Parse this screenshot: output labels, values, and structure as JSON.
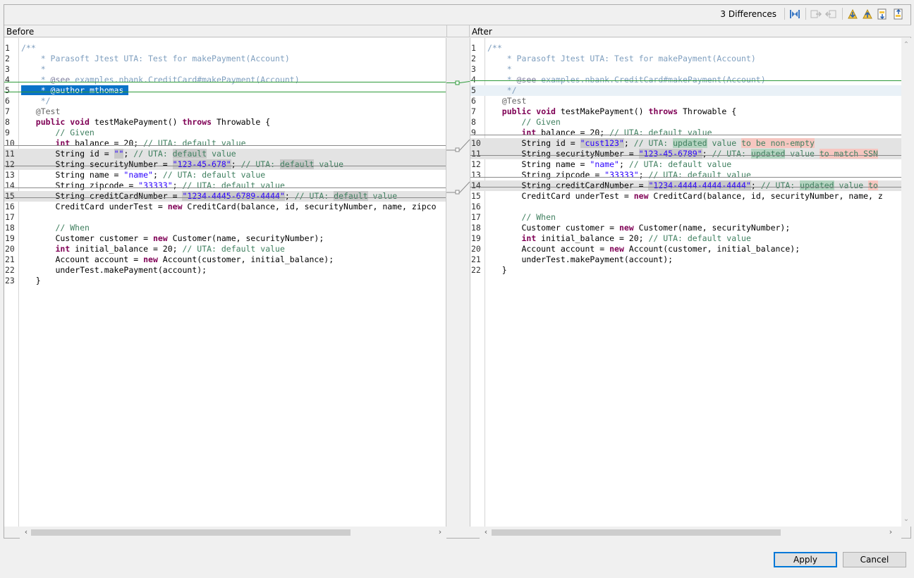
{
  "toolbar": {
    "differences_label": "3 Differences",
    "icons": [
      "copy-all-icon",
      "copy-right-icon",
      "copy-left-icon",
      "next-diff-icon",
      "prev-diff-icon",
      "next-change-icon",
      "prev-change-icon"
    ]
  },
  "panes": {
    "left_title": "Before",
    "right_title": "After"
  },
  "left_lines": [
    {
      "n": "1",
      "segs": [
        [
          "c-jd",
          "/**"
        ]
      ]
    },
    {
      "n": "2",
      "segs": [
        [
          "c-jd",
          "    * Parasoft Jtest UTA: Test for makePayment(Account)"
        ]
      ]
    },
    {
      "n": "3",
      "segs": [
        [
          "c-jd",
          "    *"
        ]
      ]
    },
    {
      "n": "4",
      "segs": [
        [
          "c-jd",
          "    * "
        ],
        [
          "c-tag",
          "@see"
        ],
        [
          "c-jd",
          " examples.nbank.CreditCard#makePayment(Account)"
        ]
      ]
    },
    {
      "n": "5",
      "sel": true,
      "segs": [
        [
          "sel-text",
          "    * "
        ],
        [
          "sel-text",
          "@author"
        ],
        [
          "sel-text",
          " mthomas "
        ]
      ]
    },
    {
      "n": "6",
      "segs": [
        [
          "c-jd",
          "    */"
        ]
      ]
    },
    {
      "n": "7",
      "segs": [
        [
          "c-ann",
          "   @Test"
        ]
      ]
    },
    {
      "n": "8",
      "segs": [
        [
          "",
          "   "
        ],
        [
          "c-kw",
          "public"
        ],
        [
          "",
          " "
        ],
        [
          "c-kw",
          "void"
        ],
        [
          "",
          " testMakePayment() "
        ],
        [
          "c-kw",
          "throws"
        ],
        [
          "",
          " Throwable {"
        ]
      ]
    },
    {
      "n": "9",
      "segs": [
        [
          "c-lc",
          "       // Given"
        ]
      ]
    },
    {
      "n": "10",
      "segs": [
        [
          "",
          "       "
        ],
        [
          "c-kw",
          "int"
        ],
        [
          "",
          " balance = 20; "
        ],
        [
          "c-lc",
          "// UTA: default value"
        ]
      ]
    },
    {
      "n": "11",
      "changed": true,
      "segs": [
        [
          "",
          "       String id = "
        ],
        [
          "c-str hl-gray",
          "\"\""
        ],
        [
          "",
          "; "
        ],
        [
          "c-lc",
          "// UTA: "
        ],
        [
          "c-lc hl-gray",
          "default"
        ],
        [
          "c-lc",
          " value"
        ]
      ]
    },
    {
      "n": "12",
      "changed": true,
      "segs": [
        [
          "",
          "       String securityNumber = "
        ],
        [
          "c-str hl-gray",
          "\"123-45-678\""
        ],
        [
          "",
          "; "
        ],
        [
          "c-lc",
          "// UTA: "
        ],
        [
          "c-lc hl-gray",
          "default"
        ],
        [
          "c-lc",
          " value"
        ]
      ]
    },
    {
      "n": "13",
      "segs": [
        [
          "",
          "       String name = "
        ],
        [
          "c-str",
          "\"name\""
        ],
        [
          "",
          "; "
        ],
        [
          "c-lc",
          "// UTA: default value"
        ]
      ]
    },
    {
      "n": "14",
      "segs": [
        [
          "",
          "       String zipcode = "
        ],
        [
          "c-str",
          "\"33333\""
        ],
        [
          "",
          "; "
        ],
        [
          "c-lc",
          "// UTA: default value"
        ]
      ]
    },
    {
      "n": "15",
      "changed": true,
      "segs": [
        [
          "",
          "       String creditCardNumber = "
        ],
        [
          "c-str hl-gray",
          "\"1234-4445-6789-4444\""
        ],
        [
          "",
          "; "
        ],
        [
          "c-lc",
          "// UTA: "
        ],
        [
          "c-lc hl-gray",
          "default"
        ],
        [
          "c-lc",
          " value"
        ]
      ]
    },
    {
      "n": "16",
      "segs": [
        [
          "",
          "       CreditCard underTest = "
        ],
        [
          "c-kw",
          "new"
        ],
        [
          "",
          " CreditCard(balance, id, securityNumber, name, zipco"
        ]
      ]
    },
    {
      "n": "17",
      "segs": [
        [
          "",
          ""
        ]
      ]
    },
    {
      "n": "18",
      "segs": [
        [
          "c-lc",
          "       // When"
        ]
      ]
    },
    {
      "n": "19",
      "segs": [
        [
          "",
          "       Customer customer = "
        ],
        [
          "c-kw",
          "new"
        ],
        [
          "",
          " Customer(name, securityNumber);"
        ]
      ]
    },
    {
      "n": "20",
      "segs": [
        [
          "",
          "       "
        ],
        [
          "c-kw",
          "int"
        ],
        [
          "",
          " initial_balance = 20; "
        ],
        [
          "c-lc",
          "// UTA: default value"
        ]
      ]
    },
    {
      "n": "21",
      "segs": [
        [
          "",
          "       Account account = "
        ],
        [
          "c-kw",
          "new"
        ],
        [
          "",
          " Account(customer, initial_balance);"
        ]
      ]
    },
    {
      "n": "22",
      "segs": [
        [
          "",
          "       underTest.makePayment(account);"
        ]
      ]
    },
    {
      "n": "23",
      "segs": [
        [
          "",
          "   }"
        ]
      ]
    }
  ],
  "right_lines": [
    {
      "n": "1",
      "segs": [
        [
          "c-jd",
          "/**"
        ]
      ]
    },
    {
      "n": "2",
      "segs": [
        [
          "c-jd",
          "    * Parasoft Jtest UTA: Test for makePayment(Account)"
        ]
      ]
    },
    {
      "n": "3",
      "segs": [
        [
          "c-jd",
          "    *"
        ]
      ]
    },
    {
      "n": "4",
      "segs": [
        [
          "c-jd",
          "    * "
        ],
        [
          "c-tag",
          "@see"
        ],
        [
          "c-jd",
          " examples.nbank.CreditCard#makePayment(Account)"
        ]
      ]
    },
    {
      "n": "5",
      "light": true,
      "segs": [
        [
          "c-jd",
          "    */"
        ]
      ]
    },
    {
      "n": "6",
      "segs": [
        [
          "c-ann",
          "   @Test"
        ]
      ]
    },
    {
      "n": "7",
      "segs": [
        [
          "",
          "   "
        ],
        [
          "c-kw",
          "public"
        ],
        [
          "",
          " "
        ],
        [
          "c-kw",
          "void"
        ],
        [
          "",
          " testMakePayment() "
        ],
        [
          "c-kw",
          "throws"
        ],
        [
          "",
          " Throwable {"
        ]
      ]
    },
    {
      "n": "8",
      "segs": [
        [
          "c-lc",
          "       // Given"
        ]
      ]
    },
    {
      "n": "9",
      "segs": [
        [
          "",
          "       "
        ],
        [
          "c-kw",
          "int"
        ],
        [
          "",
          " balance = 20; "
        ],
        [
          "c-lc",
          "// UTA: default value"
        ]
      ]
    },
    {
      "n": "10",
      "changed": true,
      "segs": [
        [
          "",
          "       String id = "
        ],
        [
          "c-str hl-gray",
          "\"cust123\""
        ],
        [
          "",
          "; "
        ],
        [
          "c-lc",
          "// UTA: "
        ],
        [
          "c-lc hl-green",
          "updated"
        ],
        [
          "c-lc",
          " value "
        ],
        [
          "c-lc hl-red",
          "to be non-empty"
        ]
      ]
    },
    {
      "n": "11",
      "changed": true,
      "segs": [
        [
          "",
          "       String securityNumber = "
        ],
        [
          "c-str hl-gray",
          "\"123-45-6789\""
        ],
        [
          "",
          "; "
        ],
        [
          "c-lc",
          "// UTA: "
        ],
        [
          "c-lc hl-green",
          "updated"
        ],
        [
          "c-lc",
          " value "
        ],
        [
          "c-lc hl-red",
          "to match SSN"
        ]
      ]
    },
    {
      "n": "12",
      "segs": [
        [
          "",
          "       String name = "
        ],
        [
          "c-str",
          "\"name\""
        ],
        [
          "",
          "; "
        ],
        [
          "c-lc",
          "// UTA: default value"
        ]
      ]
    },
    {
      "n": "13",
      "segs": [
        [
          "",
          "       String zipcode = "
        ],
        [
          "c-str",
          "\"33333\""
        ],
        [
          "",
          "; "
        ],
        [
          "c-lc",
          "// UTA: default value"
        ]
      ]
    },
    {
      "n": "14",
      "changed": true,
      "segs": [
        [
          "",
          "       String creditCardNumber = "
        ],
        [
          "c-str hl-gray",
          "\"1234-4444-4444-4444\""
        ],
        [
          "",
          "; "
        ],
        [
          "c-lc",
          "// UTA: "
        ],
        [
          "c-lc hl-green",
          "updated"
        ],
        [
          "c-lc",
          " value "
        ],
        [
          "c-lc hl-red",
          "to"
        ]
      ]
    },
    {
      "n": "15",
      "segs": [
        [
          "",
          "       CreditCard underTest = "
        ],
        [
          "c-kw",
          "new"
        ],
        [
          "",
          " CreditCard(balance, id, securityNumber, name, z"
        ]
      ]
    },
    {
      "n": "16",
      "segs": [
        [
          "",
          ""
        ]
      ]
    },
    {
      "n": "17",
      "segs": [
        [
          "c-lc",
          "       // When"
        ]
      ]
    },
    {
      "n": "18",
      "segs": [
        [
          "",
          "       Customer customer = "
        ],
        [
          "c-kw",
          "new"
        ],
        [
          "",
          " Customer(name, securityNumber);"
        ]
      ]
    },
    {
      "n": "19",
      "segs": [
        [
          "",
          "       "
        ],
        [
          "c-kw",
          "int"
        ],
        [
          "",
          " initial_balance = 20; "
        ],
        [
          "c-lc",
          "// UTA: default value"
        ]
      ]
    },
    {
      "n": "20",
      "segs": [
        [
          "",
          "       Account account = "
        ],
        [
          "c-kw",
          "new"
        ],
        [
          "",
          " Account(customer, initial_balance);"
        ]
      ]
    },
    {
      "n": "21",
      "segs": [
        [
          "",
          "       underTest.makePayment(account);"
        ]
      ]
    },
    {
      "n": "22",
      "segs": [
        [
          "",
          "   }"
        ]
      ]
    }
  ],
  "buttons": {
    "apply": "Apply",
    "cancel": "Cancel"
  },
  "colors": {
    "selection": "#0a72c8",
    "changed_line": "#e3e3e3",
    "added_text": "#f6c6c0",
    "updated_text": "#b4d4c0"
  }
}
